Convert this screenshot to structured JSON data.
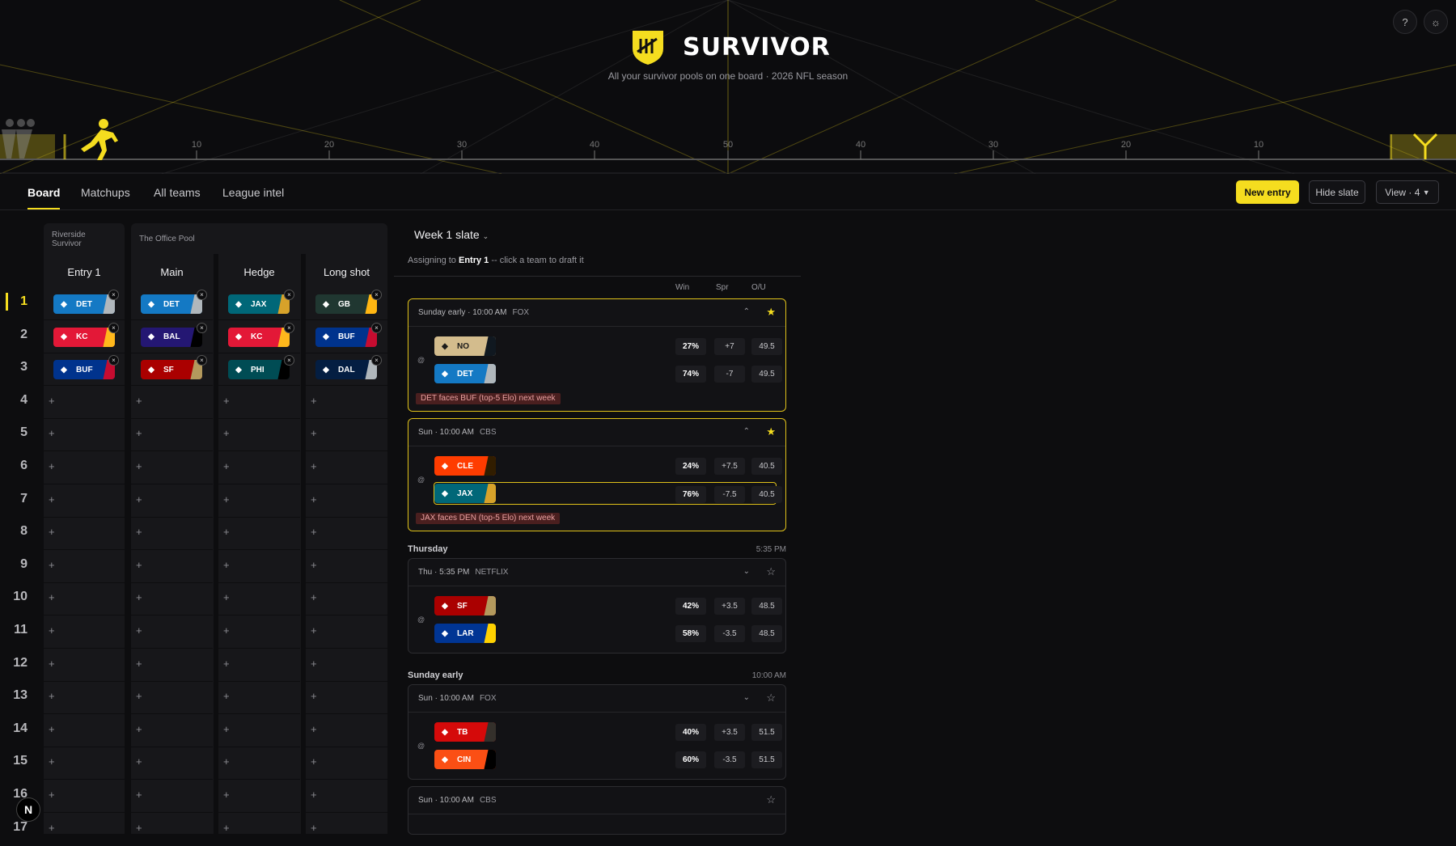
{
  "app": {
    "title": "SURVIVOR",
    "subtitle": "All your survivor pools on one board · 2026 NFL season"
  },
  "field": {
    "yard_labels": [
      "10",
      "20",
      "30",
      "40",
      "50",
      "40",
      "30",
      "20",
      "10"
    ]
  },
  "nav": {
    "tabs": [
      "Board",
      "Matchups",
      "All teams",
      "League intel"
    ],
    "active_tab": "Board"
  },
  "actions": {
    "new_entry": "New entry",
    "hide_slate": "Hide slate",
    "view": "View · 4"
  },
  "board": {
    "groups": [
      {
        "name": "Riverside Survivor",
        "entries": [
          "Entry 1"
        ]
      },
      {
        "name": "The Office Pool",
        "entries": [
          "Main",
          "Hedge",
          "Long shot"
        ]
      }
    ],
    "weeks": [
      "1",
      "2",
      "3",
      "4",
      "5",
      "6",
      "7",
      "8",
      "9",
      "10",
      "11",
      "12",
      "13",
      "14",
      "15",
      "16",
      "17"
    ],
    "active_week": "1",
    "picks": {
      "Entry 1": [
        "DET",
        "KC",
        "BUF"
      ],
      "Main": [
        "DET",
        "BAL",
        "SF"
      ],
      "Hedge": [
        "JAX",
        "KC",
        "PHI"
      ],
      "Long shot": [
        "GB",
        "BUF",
        "DAL"
      ]
    },
    "empty_symbol": "+",
    "remove_symbol": "×"
  },
  "slate": {
    "title": "Week 1 slate",
    "assign_prefix": "Assigning to",
    "assign_entry": "Entry 1",
    "assign_suffix": "-- click a team to draft it",
    "columns": [
      "Win",
      "Spr",
      "O/U"
    ],
    "games": [
      {
        "header": "Sunday early · 10:00 AM",
        "network": "FOX",
        "starred": true,
        "expanded": true,
        "teams": [
          {
            "abbr": "NO",
            "win": "27%",
            "spread": "+7",
            "ou": "49.5"
          },
          {
            "abbr": "DET",
            "win": "74%",
            "spread": "-7",
            "ou": "49.5"
          }
        ],
        "warning": "DET faces BUF (top-5 Elo) next week"
      },
      {
        "header": "Sun · 10:00 AM",
        "network": "CBS",
        "starred": true,
        "expanded": true,
        "teams": [
          {
            "abbr": "CLE",
            "win": "24%",
            "spread": "+7.5",
            "ou": "40.5"
          },
          {
            "abbr": "JAX",
            "win": "76%",
            "spread": "-7.5",
            "ou": "40.5",
            "selected": true
          }
        ],
        "warning": "JAX faces DEN (top-5 Elo) next week"
      }
    ],
    "sections": [
      {
        "name": "Thursday",
        "time": "5:35 PM",
        "games": [
          {
            "header": "Thu · 5:35 PM",
            "network": "NETFLIX",
            "starred": false,
            "teams": [
              {
                "abbr": "SF",
                "win": "42%",
                "spread": "+3.5",
                "ou": "48.5"
              },
              {
                "abbr": "LAR",
                "win": "58%",
                "spread": "-3.5",
                "ou": "48.5"
              }
            ]
          }
        ]
      },
      {
        "name": "Sunday early",
        "time": "10:00 AM",
        "games": [
          {
            "header": "Sun · 10:00 AM",
            "network": "FOX",
            "starred": false,
            "teams": [
              {
                "abbr": "TB",
                "win": "40%",
                "spread": "+3.5",
                "ou": "51.5"
              },
              {
                "abbr": "CIN",
                "win": "60%",
                "spread": "-3.5",
                "ou": "51.5"
              }
            ]
          },
          {
            "header": "Sun · 10:00 AM",
            "network": "CBS",
            "starred": false,
            "teams": []
          }
        ]
      }
    ],
    "at_symbol": "@"
  },
  "team_colors": {
    "DET": [
      "#1479c4",
      "#b0b7bc"
    ],
    "KC": [
      "#e31837",
      "#ffb81c"
    ],
    "BUF": [
      "#00338d",
      "#c60c30"
    ],
    "BAL": [
      "#241773",
      "#000000"
    ],
    "SF": [
      "#aa0000",
      "#b3995d"
    ],
    "JAX": [
      "#006778",
      "#d7a22a"
    ],
    "PHI": [
      "#004c54",
      "#000000"
    ],
    "GB": [
      "#203731",
      "#ffb612"
    ],
    "DAL": [
      "#041e42",
      "#b0b7bc"
    ],
    "NO": [
      "#d3bc8d",
      "#101820"
    ],
    "CLE": [
      "#ff3c00",
      "#311d00"
    ],
    "LAR": [
      "#003594",
      "#ffd100"
    ],
    "TB": [
      "#d50a0a",
      "#34302b"
    ],
    "CIN": [
      "#fb4f14",
      "#000000"
    ]
  },
  "team_text": {
    "NO": "#1a1a1a"
  },
  "accent": "#f5dd1f"
}
